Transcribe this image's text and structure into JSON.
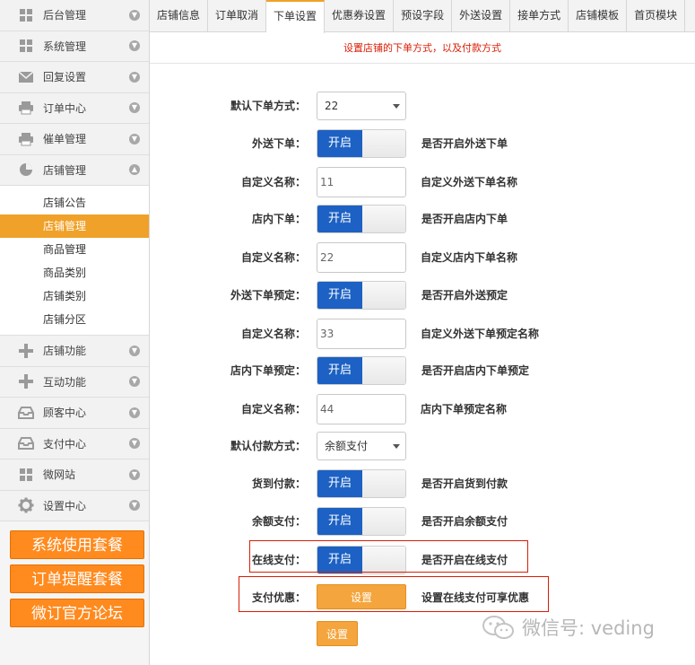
{
  "sidebar": {
    "top_items": [
      {
        "label": "后台管理",
        "icon": "grid-icon"
      },
      {
        "label": "系统管理",
        "icon": "grid-icon"
      },
      {
        "label": "回复设置",
        "icon": "mail-icon"
      },
      {
        "label": "订单中心",
        "icon": "printer-icon"
      },
      {
        "label": "催单管理",
        "icon": "printer-icon"
      },
      {
        "label": "店铺管理",
        "icon": "pie-chart-icon"
      }
    ],
    "sub_items": [
      {
        "label": "店铺公告",
        "active": false
      },
      {
        "label": "店铺管理",
        "active": true
      },
      {
        "label": "商品管理",
        "active": false
      },
      {
        "label": "商品类别",
        "active": false
      },
      {
        "label": "店铺类别",
        "active": false
      },
      {
        "label": "店铺分区",
        "active": false
      }
    ],
    "bottom_items": [
      {
        "label": "店铺功能",
        "icon": "plus-icon"
      },
      {
        "label": "互动功能",
        "icon": "plus-icon"
      },
      {
        "label": "顾客中心",
        "icon": "inbox-icon"
      },
      {
        "label": "支付中心",
        "icon": "inbox-icon"
      },
      {
        "label": "微网站",
        "icon": "grid-icon"
      },
      {
        "label": "设置中心",
        "icon": "gear-icon"
      }
    ],
    "promos": [
      "系统使用套餐",
      "订单提醒套餐",
      "微订官方论坛"
    ]
  },
  "tabs": [
    "店铺信息",
    "订单取消",
    "下单设置",
    "优惠券设置",
    "预设字段",
    "外送设置",
    "接单方式",
    "店铺模板",
    "首页模块"
  ],
  "active_tab": "下单设置",
  "notice": "设置店铺的下单方式，以及付款方式",
  "form": {
    "default_order_mode": {
      "label": "默认下单方式：",
      "value": "22"
    },
    "delivery_order": {
      "label": "外送下单：",
      "toggle": "开启",
      "desc": "是否开启外送下单"
    },
    "delivery_name": {
      "label": "自定义名称：",
      "value": "11",
      "desc": "自定义外送下单名称"
    },
    "dinein_order": {
      "label": "店内下单：",
      "toggle": "开启",
      "desc": "是否开启店内下单"
    },
    "dinein_name": {
      "label": "自定义名称：",
      "value": "22",
      "desc": "自定义店内下单名称"
    },
    "delivery_reserve": {
      "label": "外送下单预定：",
      "toggle": "开启",
      "desc": "是否开启外送预定"
    },
    "delivery_reserve_name": {
      "label": "自定义名称：",
      "value": "33",
      "desc": "自定义外送下单预定名称"
    },
    "dinein_reserve": {
      "label": "店内下单预定：",
      "toggle": "开启",
      "desc": "是否开启店内下单预定"
    },
    "dinein_reserve_name": {
      "label": "自定义名称：",
      "value": "44",
      "desc": "店内下单预定名称"
    },
    "default_payment": {
      "label": "默认付款方式：",
      "value": "余额支付"
    },
    "cod": {
      "label": "货到付款：",
      "toggle": "开启",
      "desc": "是否开启货到付款"
    },
    "balance_pay": {
      "label": "余额支付：",
      "toggle": "开启",
      "desc": "是否开启余额支付"
    },
    "online_pay": {
      "label": "在线支付：",
      "toggle": "开启",
      "desc": "是否开启在线支付"
    },
    "pay_discount": {
      "label": "支付优惠：",
      "button": "设置",
      "desc": "设置在线支付可享优惠"
    },
    "submit": "设置"
  },
  "watermark": "微信号: veding",
  "colors": {
    "accent_orange": "#f0a129",
    "toggle_blue": "#1c61c3",
    "highlight_red": "#d81e06",
    "promo_orange": "#ff8a1e"
  }
}
